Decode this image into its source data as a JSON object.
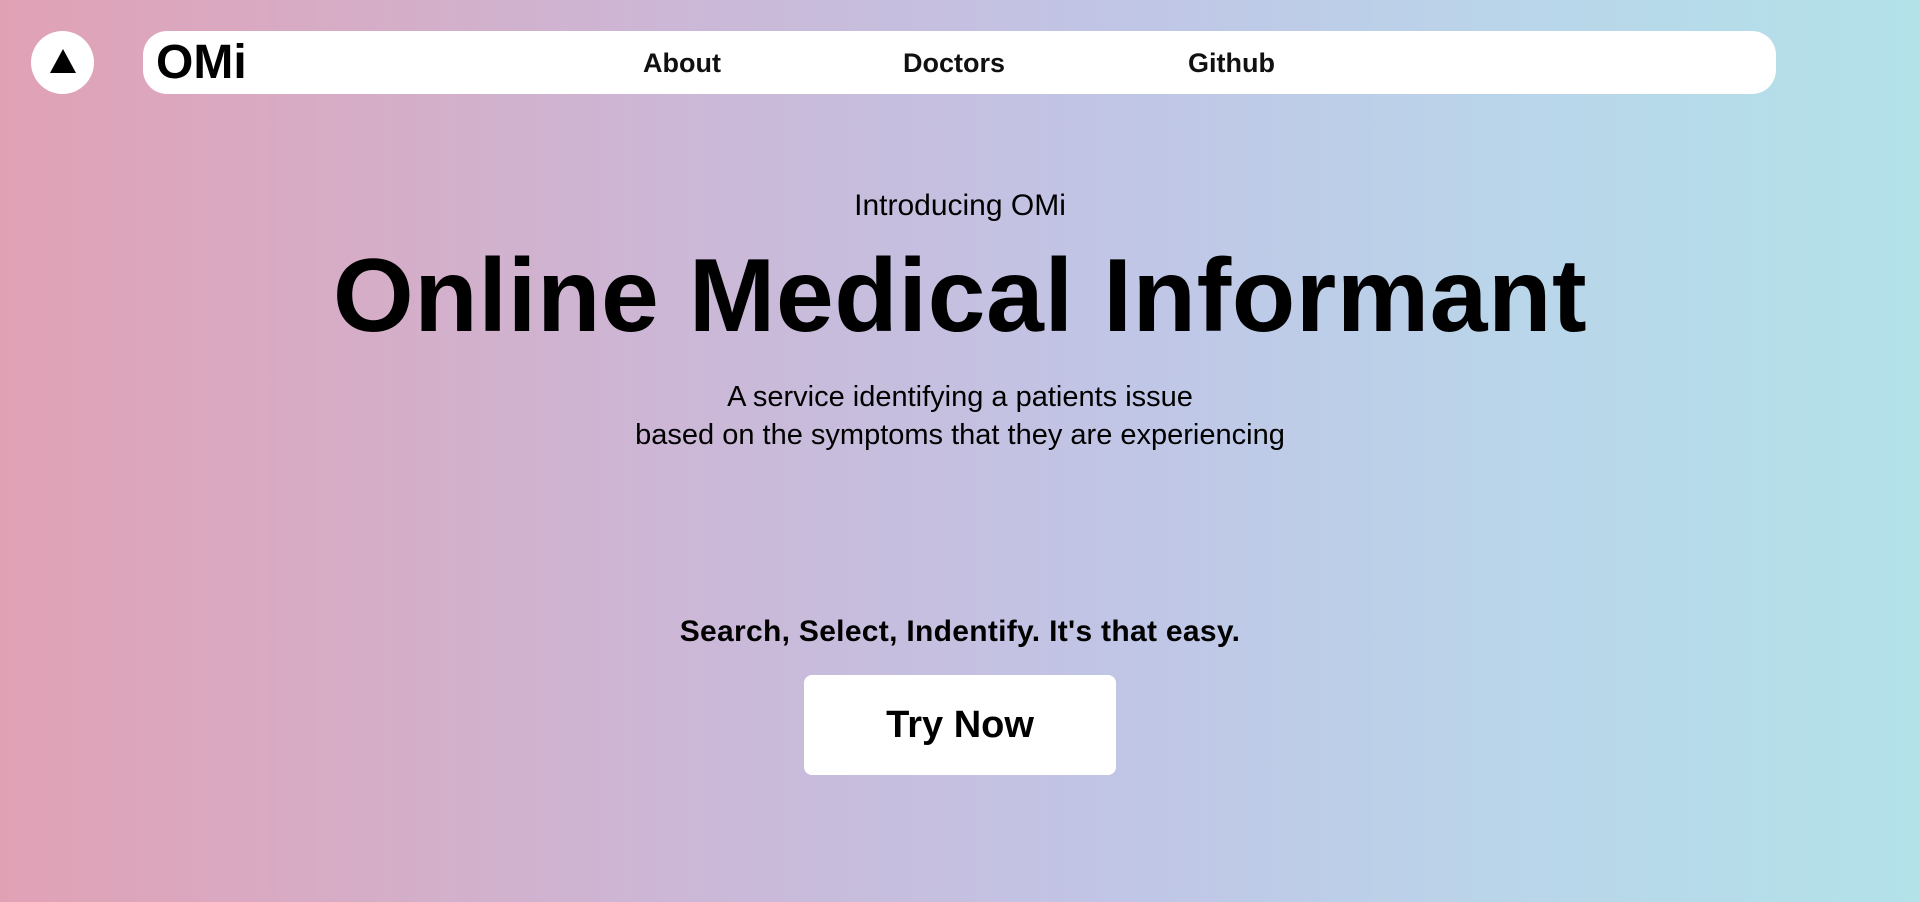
{
  "colors": {
    "gradient_start": "#e1a1b5",
    "gradient_mid": "#c1c5e6",
    "gradient_end": "#b3e2e9",
    "surface": "#ffffff",
    "text": "#000000"
  },
  "top_button": {
    "icon": "up-triangle-icon"
  },
  "navbar": {
    "brand": "OMi",
    "links": [
      {
        "label": "About"
      },
      {
        "label": "Doctors"
      },
      {
        "label": "Github"
      }
    ]
  },
  "hero": {
    "intro": "Introducing OMi",
    "headline": "Online Medical Informant",
    "subtitle_line1": "A service identifying a patients issue",
    "subtitle_line2": "based on the symptoms that they are experiencing"
  },
  "cta": {
    "tagline": "Search, Select, Indentify. It's that easy.",
    "button_label": "Try Now"
  }
}
